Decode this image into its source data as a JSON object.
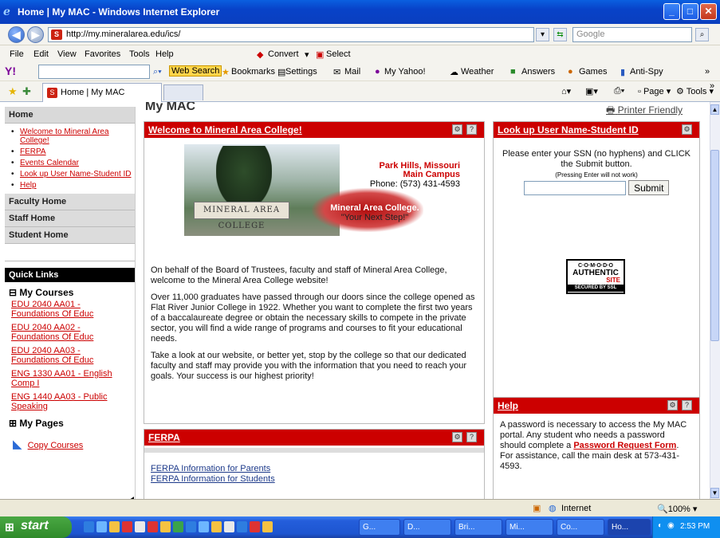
{
  "window": {
    "title": "Home | My MAC - Windows Internet Explorer"
  },
  "address": {
    "url": "http://my.mineralarea.edu/ics/",
    "search_placeholder": "Google"
  },
  "menu": [
    "File",
    "Edit",
    "View",
    "Favorites",
    "Tools",
    "Help"
  ],
  "convert": {
    "convert": "Convert",
    "select": "Select"
  },
  "ytool": {
    "web_search": "Web Search",
    "bookmarks": "Bookmarks",
    "settings": "Settings",
    "mail": "Mail",
    "my_yahoo": "My Yahoo!",
    "weather": "Weather",
    "answers": "Answers",
    "games": "Games",
    "antispy": "Anti-Spy"
  },
  "tab": {
    "label": "Home | My MAC",
    "page": "Page",
    "tools": "Tools"
  },
  "page": {
    "title": "My MAC",
    "printer": "Printer Friendly"
  },
  "leftnav": {
    "home": "Home",
    "home_links": [
      "Welcome to Mineral Area College!",
      "FERPA",
      "Events Calendar",
      "Look up User Name-Student ID",
      "Help"
    ],
    "faculty": "Faculty Home",
    "staff": "Staff Home",
    "student": "Student Home",
    "quick_links": "Quick Links",
    "my_courses": "My Courses",
    "courses": [
      "EDU 2040 AA01 - Foundations Of Educ",
      "EDU 2040 AA02 - Foundations Of Educ",
      "EDU 2040 AA03 - Foundations Of Educ",
      "ENG 1330 AA01 - English Comp I",
      "ENG 1440 AA03 - Public Speaking"
    ],
    "my_pages": "My Pages",
    "copy_courses": "Copy Courses"
  },
  "welcome": {
    "title": "Welcome to Mineral Area College!",
    "campus_line1": "Park Hills, Missouri",
    "campus_line2": "Main Campus",
    "campus_phone": "Phone: (573) 431-4593",
    "sign": "MINERAL AREA COLLEGE",
    "slogan1": "Mineral Area College.",
    "slogan2": "\"Your Next Step!\"",
    "p1": "On behalf of the Board of Trustees, faculty and staff of Mineral Area College, welcome to the Mineral Area College website!",
    "p2": "Over 11,000 graduates have passed through our doors since the college opened as Flat River Junior College in 1922. Whether you want to complete the first two years of a baccalaureate degree or obtain the necessary skills to compete in the private sector, you will find a wide range of programs and courses to fit your educational needs.",
    "p3": "Take a look at our website, or better yet, stop by the college so that our dedicated faculty and staff may provide you with the information that you need to reach your goals. Your success is our highest priority!"
  },
  "lookup": {
    "title": "Look up User Name-Student ID",
    "instr": "Please enter your SSN (no hyphens) and CLICK the Submit button.",
    "note": "(Pressing Enter will not work)",
    "submit": "Submit",
    "seal1": "C·O·M·O·D·O",
    "seal2": "AUTHENTIC",
    "seal3": "SITE",
    "seal4": "SECURED BY SSL"
  },
  "help": {
    "title": "Help",
    "text1": "A password is necessary to access the My MAC portal. Any student who needs a password should complete a ",
    "link": "Password Request Form",
    "text2": ". For assistance, call the main desk at 573-431-4593."
  },
  "ferpa": {
    "title": "FERPA",
    "links": [
      "FERPA Information for Parents",
      "FERPA Information for Students"
    ]
  },
  "status": {
    "zone": "Internet",
    "zoom": "100%"
  },
  "taskbar": {
    "start": "start",
    "items": [
      "G...",
      "D...",
      "Bri...",
      "Mi...",
      "Co...",
      "Ho..."
    ],
    "clock": "2:53 PM"
  }
}
